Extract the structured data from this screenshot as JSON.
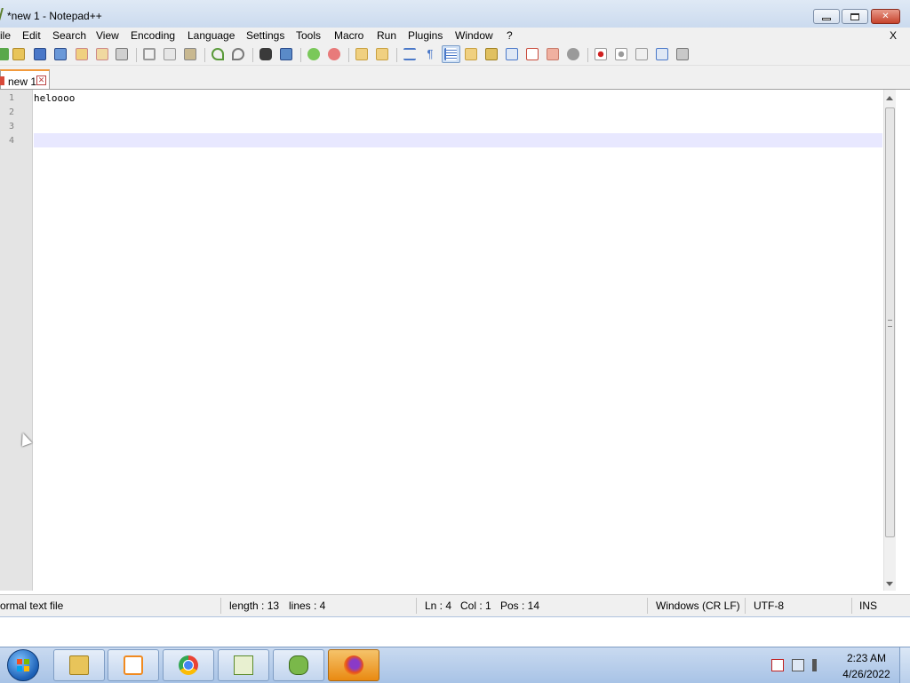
{
  "window": {
    "title": "*new 1 - Notepad++",
    "minimize_glyph": "",
    "close_glyph": "✕"
  },
  "menu": {
    "items": [
      "ile",
      "Edit",
      "Search",
      "View",
      "Encoding",
      "Language",
      "Settings",
      "Tools",
      "Macro",
      "Run",
      "Plugins",
      "Window",
      "?"
    ],
    "close_label": "X"
  },
  "toolbar": {
    "icons": [
      "new-file-icon",
      "open-file-icon",
      "save-icon",
      "save-all-icon",
      "close-icon",
      "close-all-icon",
      "print-icon",
      "cut-icon",
      "copy-icon",
      "paste-icon",
      "undo-icon",
      "redo-icon",
      "find-icon",
      "replace-icon",
      "zoom-in-icon",
      "zoom-out-icon",
      "sync-vertical-icon",
      "sync-horizontal-icon",
      "word-wrap-icon",
      "show-all-chars-icon",
      "indent-guide-icon",
      "user-defined-lang-icon",
      "doc-map-icon",
      "function-list-icon",
      "folder-workspace-icon",
      "monitoring-icon",
      "record-macro-icon",
      "stop-record-icon",
      "playback-macro-icon",
      "run-macro-multiple-icon",
      "save-macro-icon"
    ],
    "active_icon": "indent-guide-icon"
  },
  "tabs": [
    {
      "label": "new 1",
      "close": "✕"
    }
  ],
  "editor": {
    "line_numbers": [
      "1",
      "2",
      "3",
      "4"
    ],
    "lines": [
      "heloooo",
      "",
      "",
      ""
    ],
    "current_line": 4
  },
  "status": {
    "file_type": "ormal text file",
    "length": "length : 13",
    "lines": "lines : 4",
    "ln": "Ln : 4",
    "col": "Col : 1",
    "pos": "Pos : 14",
    "eol": "Windows (CR LF)",
    "encoding": "UTF-8",
    "mode": "INS"
  },
  "taskbar": {
    "apps": [
      "file-explorer-icon",
      "media-player-icon",
      "chrome-icon",
      "notepad-plus-plus-icon",
      "network-tool-icon",
      "firefox-icon"
    ],
    "active_app": "firefox-icon",
    "time": "2:23 AM",
    "date": "4/26/2022"
  },
  "colors": {
    "current_line_bg": "#e8e8ff",
    "tab_accent": "#f29a3c",
    "taskbar_active": "#e98a12"
  }
}
